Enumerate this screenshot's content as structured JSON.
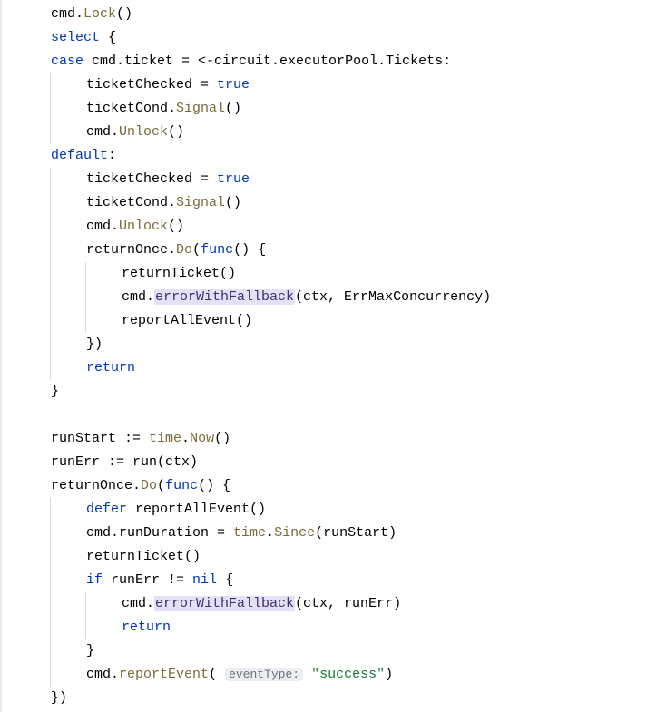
{
  "theme": {
    "bg": "#ffffff",
    "fg": "#000000",
    "keyword": "#0037b3",
    "method": "#7a6a3a",
    "highlight_bg": "#e4e0f5",
    "highlight_fg": "#403070",
    "string": "#1a7a32",
    "hint_bg": "#eceef1",
    "hint_fg": "#6c707a",
    "guide": "#d8dbe0",
    "gutter_border": "#e8e8e8"
  },
  "code": {
    "lines": [
      {
        "indent": 1,
        "guides": [],
        "tokens": [
          {
            "t": "cmd.",
            "c": "plain"
          },
          {
            "t": "Lock",
            "c": "method"
          },
          {
            "t": "()",
            "c": "plain"
          }
        ]
      },
      {
        "indent": 1,
        "guides": [],
        "tokens": [
          {
            "t": "select",
            "c": "kw"
          },
          {
            "t": " {",
            "c": "plain"
          }
        ]
      },
      {
        "indent": 1,
        "guides": [],
        "tokens": [
          {
            "t": "case",
            "c": "kw"
          },
          {
            "t": " cmd.ticket = <-circuit.executorPool.Tickets:",
            "c": "plain"
          }
        ]
      },
      {
        "indent": 2,
        "guides": [
          1
        ],
        "tokens": [
          {
            "t": "ticketChecked = ",
            "c": "plain"
          },
          {
            "t": "true",
            "c": "bool"
          }
        ]
      },
      {
        "indent": 2,
        "guides": [
          1
        ],
        "tokens": [
          {
            "t": "ticketCond.",
            "c": "plain"
          },
          {
            "t": "Signal",
            "c": "method"
          },
          {
            "t": "()",
            "c": "plain"
          }
        ]
      },
      {
        "indent": 2,
        "guides": [
          1
        ],
        "tokens": [
          {
            "t": "cmd.",
            "c": "plain"
          },
          {
            "t": "Unlock",
            "c": "method"
          },
          {
            "t": "()",
            "c": "plain"
          }
        ]
      },
      {
        "indent": 1,
        "guides": [],
        "tokens": [
          {
            "t": "default",
            "c": "kw"
          },
          {
            "t": ":",
            "c": "plain"
          }
        ]
      },
      {
        "indent": 2,
        "guides": [
          1
        ],
        "tokens": [
          {
            "t": "ticketChecked = ",
            "c": "plain"
          },
          {
            "t": "true",
            "c": "bool"
          }
        ]
      },
      {
        "indent": 2,
        "guides": [
          1
        ],
        "tokens": [
          {
            "t": "ticketCond.",
            "c": "plain"
          },
          {
            "t": "Signal",
            "c": "method"
          },
          {
            "t": "()",
            "c": "plain"
          }
        ]
      },
      {
        "indent": 2,
        "guides": [
          1
        ],
        "tokens": [
          {
            "t": "cmd.",
            "c": "plain"
          },
          {
            "t": "Unlock",
            "c": "method"
          },
          {
            "t": "()",
            "c": "plain"
          }
        ]
      },
      {
        "indent": 2,
        "guides": [
          1
        ],
        "tokens": [
          {
            "t": "returnOnce.",
            "c": "plain"
          },
          {
            "t": "Do",
            "c": "method"
          },
          {
            "t": "(",
            "c": "plain"
          },
          {
            "t": "func",
            "c": "kw"
          },
          {
            "t": "() {",
            "c": "plain"
          }
        ]
      },
      {
        "indent": 3,
        "guides": [
          1,
          2
        ],
        "tokens": [
          {
            "t": "returnTicket()",
            "c": "plain"
          }
        ]
      },
      {
        "indent": 3,
        "guides": [
          1,
          2
        ],
        "tokens": [
          {
            "t": "cmd.",
            "c": "plain"
          },
          {
            "t": "errorWithFallback",
            "c": "hl"
          },
          {
            "t": "(ctx, ErrMaxConcurrency)",
            "c": "plain"
          }
        ]
      },
      {
        "indent": 3,
        "guides": [
          1,
          2
        ],
        "tokens": [
          {
            "t": "reportAllEvent()",
            "c": "plain"
          }
        ]
      },
      {
        "indent": 2,
        "guides": [
          1
        ],
        "tokens": [
          {
            "t": "})",
            "c": "plain"
          }
        ]
      },
      {
        "indent": 2,
        "guides": [
          1
        ],
        "tokens": [
          {
            "t": "return",
            "c": "kw"
          }
        ]
      },
      {
        "indent": 1,
        "guides": [],
        "tokens": [
          {
            "t": "}",
            "c": "plain"
          }
        ]
      },
      {
        "indent": 1,
        "guides": [],
        "tokens": [
          {
            "t": "",
            "c": "plain"
          }
        ]
      },
      {
        "indent": 1,
        "guides": [],
        "tokens": [
          {
            "t": "runStart := ",
            "c": "plain"
          },
          {
            "t": "time",
            "c": "pkg"
          },
          {
            "t": ".",
            "c": "plain"
          },
          {
            "t": "Now",
            "c": "method"
          },
          {
            "t": "()",
            "c": "plain"
          }
        ]
      },
      {
        "indent": 1,
        "guides": [],
        "tokens": [
          {
            "t": "runErr := run(ctx)",
            "c": "plain"
          }
        ]
      },
      {
        "indent": 1,
        "guides": [],
        "tokens": [
          {
            "t": "returnOnce.",
            "c": "plain"
          },
          {
            "t": "Do",
            "c": "method"
          },
          {
            "t": "(",
            "c": "plain"
          },
          {
            "t": "func",
            "c": "kw"
          },
          {
            "t": "() {",
            "c": "plain"
          }
        ]
      },
      {
        "indent": 2,
        "guides": [
          1
        ],
        "tokens": [
          {
            "t": "defer",
            "c": "kw"
          },
          {
            "t": " reportAllEvent()",
            "c": "plain"
          }
        ]
      },
      {
        "indent": 2,
        "guides": [
          1
        ],
        "tokens": [
          {
            "t": "cmd.runDuration = ",
            "c": "plain"
          },
          {
            "t": "time",
            "c": "pkg"
          },
          {
            "t": ".",
            "c": "plain"
          },
          {
            "t": "Since",
            "c": "method"
          },
          {
            "t": "(runStart)",
            "c": "plain"
          }
        ]
      },
      {
        "indent": 2,
        "guides": [
          1
        ],
        "tokens": [
          {
            "t": "returnTicket()",
            "c": "plain"
          }
        ]
      },
      {
        "indent": 2,
        "guides": [
          1
        ],
        "tokens": [
          {
            "t": "if",
            "c": "kw"
          },
          {
            "t": " runErr != ",
            "c": "plain"
          },
          {
            "t": "nil",
            "c": "nil"
          },
          {
            "t": " {",
            "c": "plain"
          }
        ]
      },
      {
        "indent": 3,
        "guides": [
          1,
          2
        ],
        "tokens": [
          {
            "t": "cmd.",
            "c": "plain"
          },
          {
            "t": "errorWithFallback",
            "c": "hl"
          },
          {
            "t": "(ctx, runErr)",
            "c": "plain"
          }
        ]
      },
      {
        "indent": 3,
        "guides": [
          1,
          2
        ],
        "tokens": [
          {
            "t": "return",
            "c": "kw"
          }
        ]
      },
      {
        "indent": 2,
        "guides": [
          1
        ],
        "tokens": [
          {
            "t": "}",
            "c": "plain"
          }
        ]
      },
      {
        "indent": 2,
        "guides": [
          1
        ],
        "tokens": [
          {
            "t": "cmd.",
            "c": "plain"
          },
          {
            "t": "reportEvent",
            "c": "method"
          },
          {
            "t": "( ",
            "c": "plain"
          },
          {
            "t": "eventType:",
            "c": "hint"
          },
          {
            "t": " ",
            "c": "plain"
          },
          {
            "t": "\"success\"",
            "c": "str"
          },
          {
            "t": ")",
            "c": "plain"
          }
        ]
      },
      {
        "indent": 1,
        "guides": [],
        "tokens": [
          {
            "t": "})",
            "c": "plain"
          }
        ]
      }
    ]
  }
}
